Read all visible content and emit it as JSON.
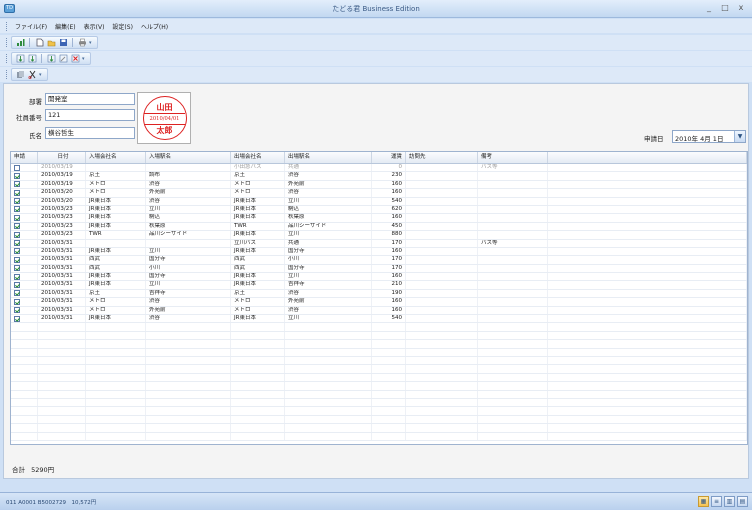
{
  "window": {
    "title": "たどる君 Business Edition",
    "app_icon": "TD",
    "controls": {
      "minimize": "_",
      "maximize": "□",
      "close": "x"
    }
  },
  "menu": [
    {
      "label": "ファイル(F)"
    },
    {
      "label": "編集(E)"
    },
    {
      "label": "表示(V)"
    },
    {
      "label": "設定(S)"
    },
    {
      "label": "ヘルプ(H)"
    }
  ],
  "form": {
    "department_label": "部署",
    "department_value": "開発室",
    "employee_no_label": "社員番号",
    "employee_no_value": "121",
    "name_label": "氏名",
    "name_value": "横谷哲生",
    "application_date_label": "申請日",
    "application_date_value": "2010年 4月 1日"
  },
  "seal": {
    "top": "山田",
    "date": "2010/04/01",
    "bottom": "太郎",
    "color": "#dd2222"
  },
  "table": {
    "columns": [
      "申請",
      "日付",
      "入場会社名",
      "入場駅名",
      "出場会社名",
      "出場駅名",
      "運賃",
      "訪問先",
      "備考"
    ],
    "rows": [
      {
        "checked": false,
        "grey": true,
        "date": "2010/03/19",
        "in_co": "",
        "in_st": "",
        "out_co": "小田急バス",
        "out_st": "共通",
        "fare": "0",
        "visit": "",
        "note": "バス等"
      },
      {
        "checked": true,
        "grey": false,
        "date": "2010/03/19",
        "in_co": "京王",
        "in_st": "調布",
        "out_co": "京王",
        "out_st": "渋谷",
        "fare": "230",
        "visit": "",
        "note": ""
      },
      {
        "checked": true,
        "grey": false,
        "date": "2010/03/19",
        "in_co": "メトロ",
        "in_st": "渋谷",
        "out_co": "メトロ",
        "out_st": "外苑前",
        "fare": "160",
        "visit": "",
        "note": ""
      },
      {
        "checked": true,
        "grey": false,
        "date": "2010/03/20",
        "in_co": "メトロ",
        "in_st": "外苑前",
        "out_co": "メトロ",
        "out_st": "渋谷",
        "fare": "160",
        "visit": "",
        "note": ""
      },
      {
        "checked": true,
        "grey": false,
        "date": "2010/03/20",
        "in_co": "JR東日本",
        "in_st": "渋谷",
        "out_co": "JR東日本",
        "out_st": "立川",
        "fare": "540",
        "visit": "",
        "note": ""
      },
      {
        "checked": true,
        "grey": false,
        "date": "2010/03/23",
        "in_co": "JR東日本",
        "in_st": "立川",
        "out_co": "JR東日本",
        "out_st": "駒込",
        "fare": "620",
        "visit": "",
        "note": ""
      },
      {
        "checked": true,
        "grey": false,
        "date": "2010/03/23",
        "in_co": "JR東日本",
        "in_st": "駒込",
        "out_co": "JR東日本",
        "out_st": "秋葉原",
        "fare": "160",
        "visit": "",
        "note": ""
      },
      {
        "checked": true,
        "grey": false,
        "date": "2010/03/23",
        "in_co": "JR東日本",
        "in_st": "秋葉原",
        "out_co": "TWR",
        "out_st": "品川シーサイド",
        "fare": "450",
        "visit": "",
        "note": ""
      },
      {
        "checked": true,
        "grey": false,
        "date": "2010/03/23",
        "in_co": "TWR",
        "in_st": "品川シーサイド",
        "out_co": "JR東日本",
        "out_st": "立川",
        "fare": "880",
        "visit": "",
        "note": ""
      },
      {
        "checked": true,
        "grey": false,
        "date": "2010/03/31",
        "in_co": "",
        "in_st": "",
        "out_co": "立川バス",
        "out_st": "共通",
        "fare": "170",
        "visit": "",
        "note": "バス等"
      },
      {
        "checked": true,
        "grey": false,
        "date": "2010/03/31",
        "in_co": "JR東日本",
        "in_st": "立川",
        "out_co": "JR東日本",
        "out_st": "国分寺",
        "fare": "160",
        "visit": "",
        "note": ""
      },
      {
        "checked": true,
        "grey": false,
        "date": "2010/03/31",
        "in_co": "西武",
        "in_st": "国分寺",
        "out_co": "西武",
        "out_st": "小川",
        "fare": "170",
        "visit": "",
        "note": ""
      },
      {
        "checked": true,
        "grey": false,
        "date": "2010/03/31",
        "in_co": "西武",
        "in_st": "小川",
        "out_co": "西武",
        "out_st": "国分寺",
        "fare": "170",
        "visit": "",
        "note": ""
      },
      {
        "checked": true,
        "grey": false,
        "date": "2010/03/31",
        "in_co": "JR東日本",
        "in_st": "国分寺",
        "out_co": "JR東日本",
        "out_st": "立川",
        "fare": "160",
        "visit": "",
        "note": ""
      },
      {
        "checked": true,
        "grey": false,
        "date": "2010/03/31",
        "in_co": "JR東日本",
        "in_st": "立川",
        "out_co": "JR東日本",
        "out_st": "吉祥寺",
        "fare": "210",
        "visit": "",
        "note": ""
      },
      {
        "checked": true,
        "grey": false,
        "date": "2010/03/31",
        "in_co": "京王",
        "in_st": "吉祥寺",
        "out_co": "京王",
        "out_st": "渋谷",
        "fare": "190",
        "visit": "",
        "note": ""
      },
      {
        "checked": true,
        "grey": false,
        "date": "2010/03/31",
        "in_co": "メトロ",
        "in_st": "渋谷",
        "out_co": "メトロ",
        "out_st": "外苑前",
        "fare": "160",
        "visit": "",
        "note": ""
      },
      {
        "checked": true,
        "grey": false,
        "date": "2010/03/31",
        "in_co": "メトロ",
        "in_st": "外苑前",
        "out_co": "メトロ",
        "out_st": "渋谷",
        "fare": "160",
        "visit": "",
        "note": ""
      },
      {
        "checked": true,
        "grey": false,
        "date": "2010/03/31",
        "in_co": "JR東日本",
        "in_st": "渋谷",
        "out_co": "JR東日本",
        "out_st": "立川",
        "fare": "540",
        "visit": "",
        "note": ""
      }
    ]
  },
  "total": {
    "label": "合計",
    "value": "5290円"
  },
  "status": {
    "text": "011 A0001 B5002729　10,572円"
  }
}
